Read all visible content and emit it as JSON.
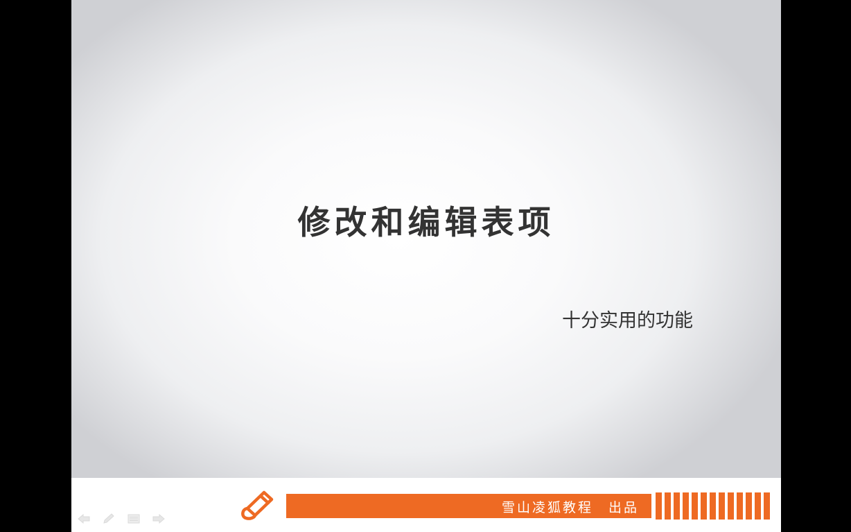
{
  "slide": {
    "title": "修改和编辑表项",
    "subtitle": "十分实用的功能"
  },
  "footer": {
    "brand_text": "雪山凌狐教程　出品",
    "accent_color": "#ee6a23",
    "stripe_count": 13,
    "logo_icon": "pencil-logo-icon"
  },
  "nav_controls": {
    "icons": [
      "arrow-left-icon",
      "pen-icon",
      "menu-icon",
      "arrow-right-icon"
    ]
  }
}
